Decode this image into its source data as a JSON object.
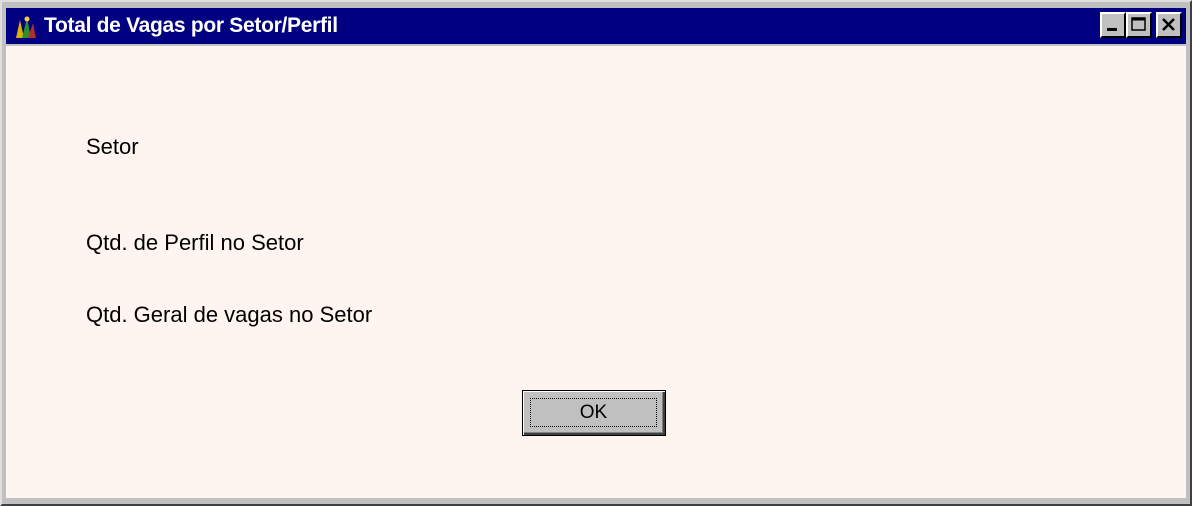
{
  "window": {
    "title": "Total de Vagas por Setor/Perfil",
    "icon": "app-icon",
    "controls": {
      "minimize_icon": "minimize-icon",
      "maximize_icon": "maximize-icon",
      "close_icon": "close-icon"
    }
  },
  "fields": {
    "setor_label": "Setor",
    "perfil_label": "Qtd. de Perfil no Setor",
    "geral_label": "Qtd. Geral de vagas no Setor"
  },
  "actions": {
    "ok_label": "OK"
  },
  "colors": {
    "titlebar": "#000080",
    "client_background": "#fef5f0",
    "button_face": "#c0c0c0"
  }
}
